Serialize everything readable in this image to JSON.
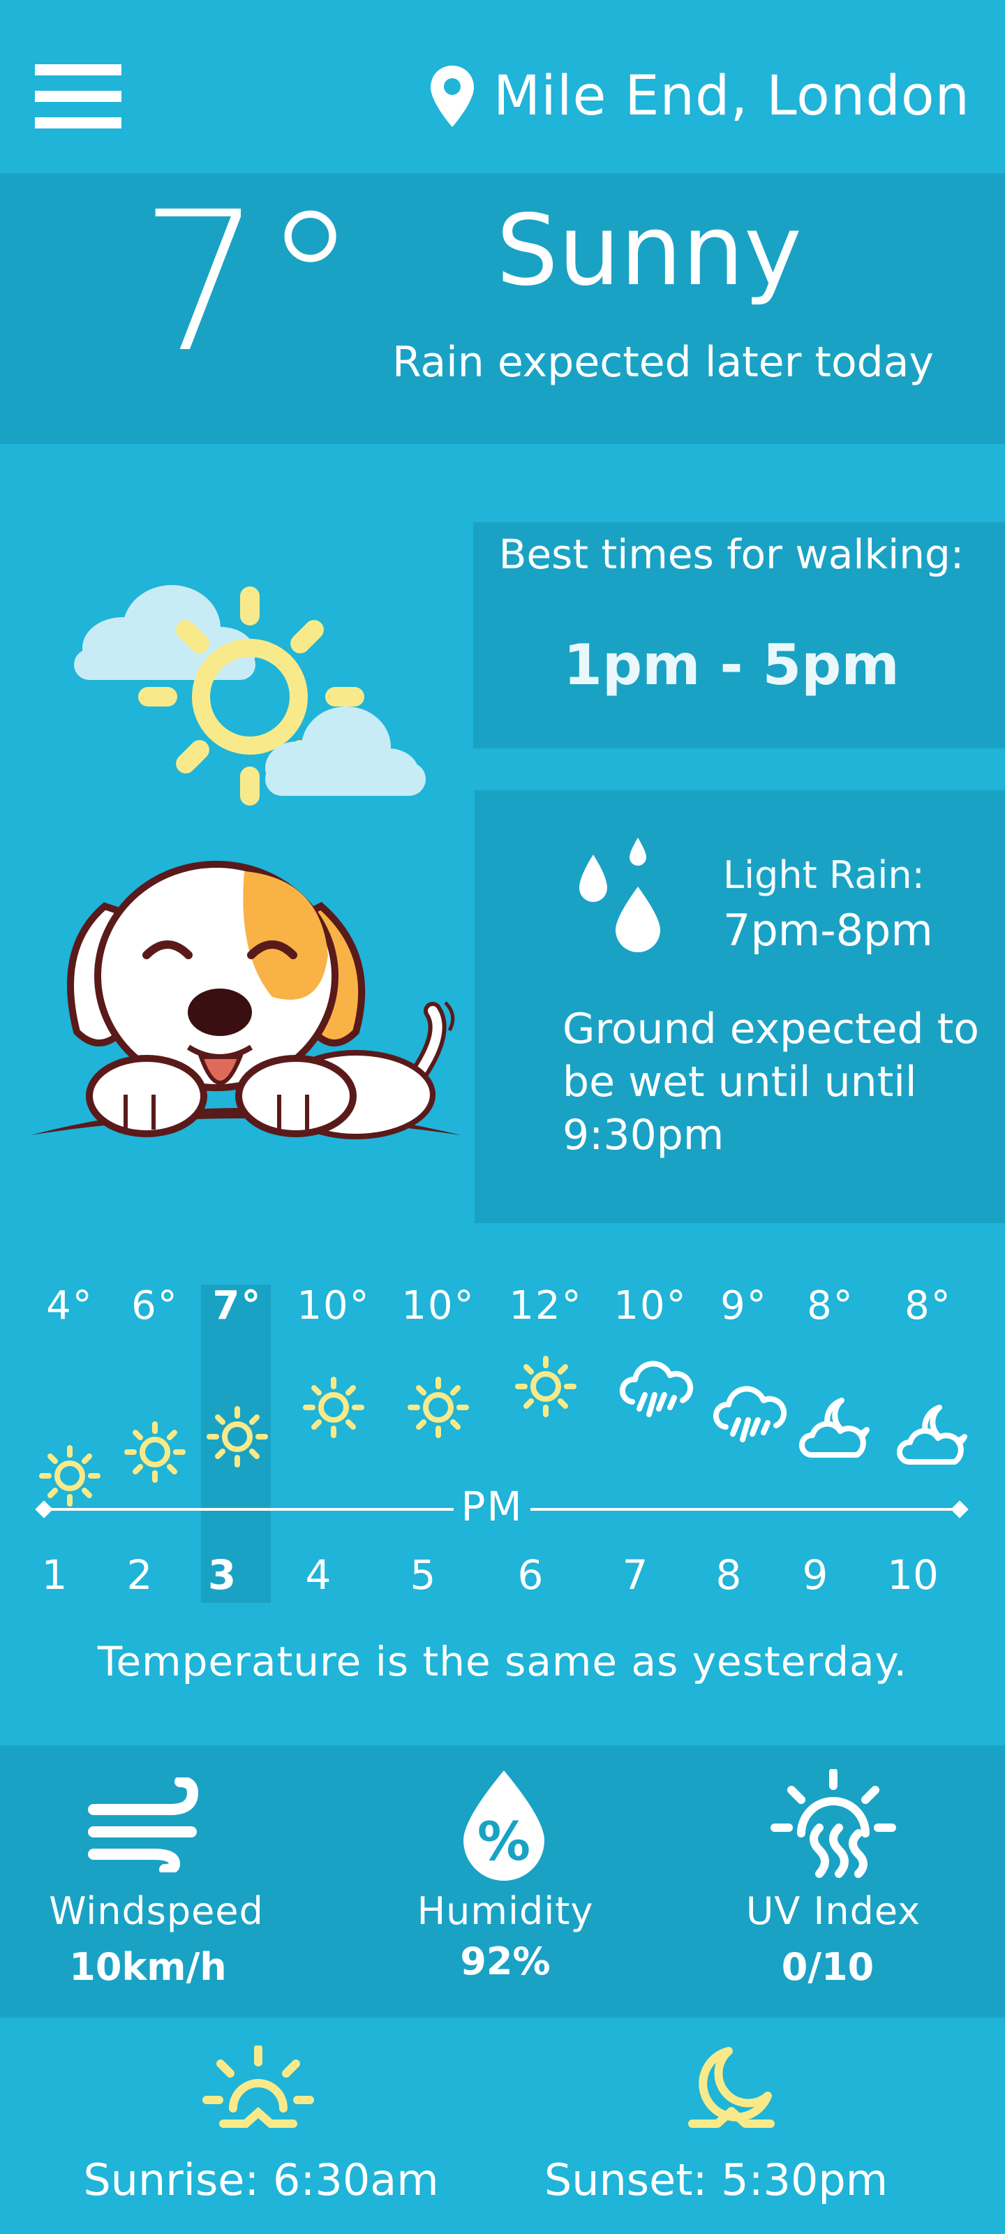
{
  "header": {
    "menu_icon": "hamburger-menu-icon",
    "location_icon": "map-pin-icon",
    "location": "Mile End, London"
  },
  "current": {
    "temperature": "7°",
    "condition": "Sunny",
    "note": "Rain expected later today"
  },
  "walking": {
    "title": "Best times for walking:",
    "times": "1pm - 5pm"
  },
  "rain": {
    "icon": "rain-drops-icon",
    "label": "Light Rain:",
    "time": "7pm-8pm",
    "ground": "Ground expected to be wet until until 9:30pm"
  },
  "hourly": {
    "period_label": "PM",
    "selected_index": 2,
    "items": [
      {
        "hour": "1",
        "temp": "4°",
        "icon": "sun-icon"
      },
      {
        "hour": "2",
        "temp": "6°",
        "icon": "sun-icon"
      },
      {
        "hour": "3",
        "temp": "7°",
        "icon": "sun-icon"
      },
      {
        "hour": "4",
        "temp": "10°",
        "icon": "sun-icon"
      },
      {
        "hour": "5",
        "temp": "10°",
        "icon": "sun-icon"
      },
      {
        "hour": "6",
        "temp": "12°",
        "icon": "sun-icon"
      },
      {
        "hour": "7",
        "temp": "10°",
        "icon": "rain-cloud-icon"
      },
      {
        "hour": "8",
        "temp": "9°",
        "icon": "rain-cloud-icon"
      },
      {
        "hour": "9",
        "temp": "8°",
        "icon": "moon-cloud-icon"
      },
      {
        "hour": "10",
        "temp": "8°",
        "icon": "moon-cloud-icon"
      }
    ],
    "comparison": "Temperature is the same as yesterday."
  },
  "stats": {
    "wind": {
      "label": "Windspeed",
      "value": "10km/h",
      "icon": "wind-icon"
    },
    "humidity": {
      "label": "Humidity",
      "value": "92%",
      "icon": "humidity-drop-icon"
    },
    "uv": {
      "label": "UV Index",
      "value": "0/10",
      "icon": "uv-sun-icon"
    }
  },
  "sun": {
    "sunrise": "Sunrise: 6:30am",
    "sunset": "Sunset: 5:30pm"
  },
  "colors": {
    "background": "#1fb4d8",
    "panel": "#1aa2c4",
    "sun_yellow": "#f8ea8a",
    "text": "#ffffff"
  }
}
